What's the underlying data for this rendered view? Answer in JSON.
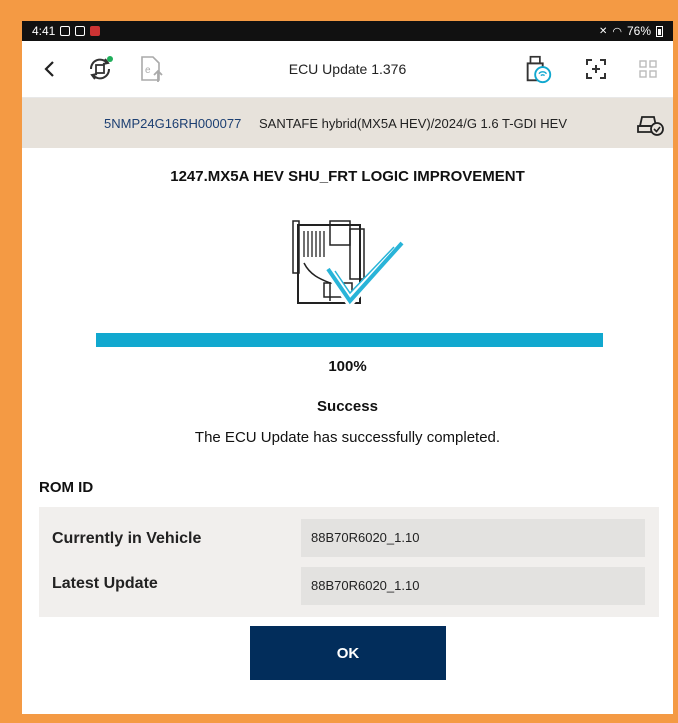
{
  "status_bar": {
    "time": "4:41",
    "battery": "76%",
    "notification_icons": [
      "gallery-icon",
      "contact-icon",
      "calendar-icon"
    ],
    "system_icons": [
      "mute-icon",
      "wifi-icon",
      "battery-icon"
    ]
  },
  "toolbar": {
    "title": "ECU Update 1.376",
    "icons": [
      "back-icon",
      "update-settings-icon",
      "file-upload-icon",
      "vci-wifi-icon",
      "screen-capture-icon",
      "grid-icon"
    ]
  },
  "vehicle": {
    "vin": "5NMP24G16RH000077",
    "description": "SANTAFE hybrid(MX5A HEV)/2024/G 1.6 T-GDI HEV"
  },
  "update": {
    "heading": "1247.MX5A HEV SHU_FRT LOGIC IMPROVEMENT",
    "progress_fraction": 1.0,
    "percent_label": "100%",
    "status": "Success",
    "message": "The ECU Update has successfully completed."
  },
  "rom": {
    "label": "ROM ID",
    "rows": [
      {
        "label": "Currently in Vehicle",
        "value": "88B70R6020_1.10"
      },
      {
        "label": "Latest Update",
        "value": "88B70R6020_1.10"
      }
    ]
  },
  "ok_label": "OK",
  "colors": {
    "frame": "#f49a44",
    "accent_progress": "#11a8cf",
    "button": "#022d5b",
    "vin_text": "#1c3f72",
    "vehicle_bar": "#e7e2db"
  }
}
